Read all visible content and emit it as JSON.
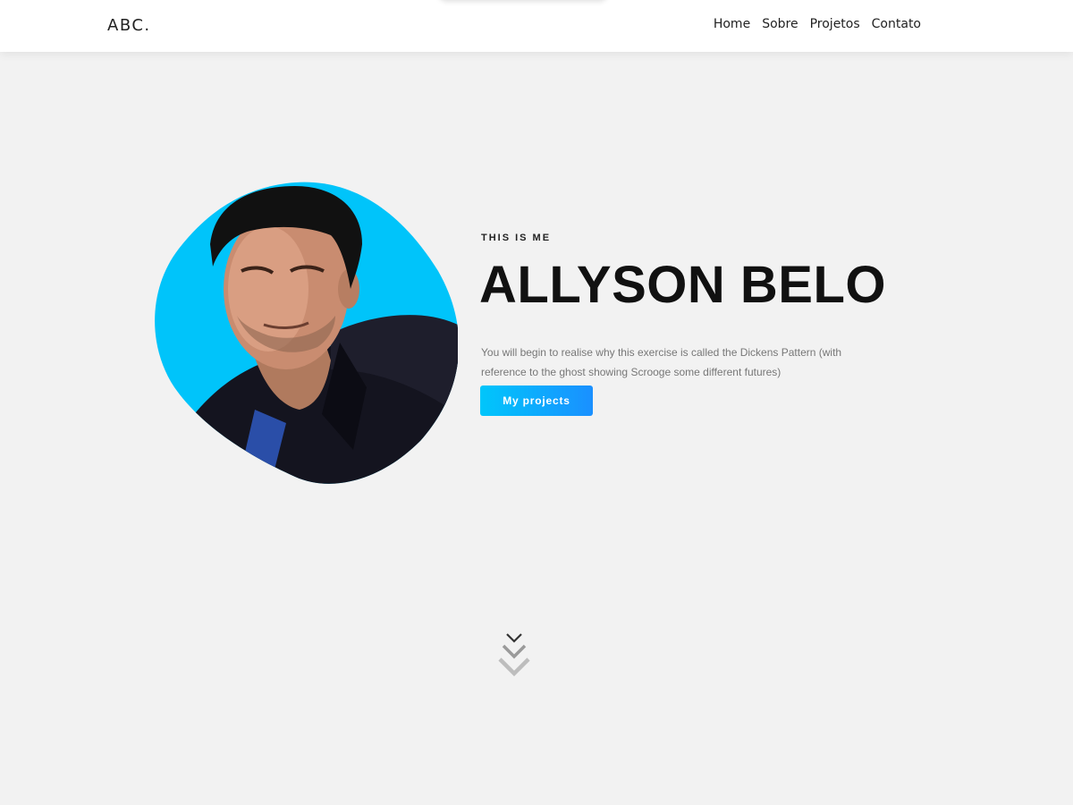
{
  "header": {
    "brand": "ABC.",
    "nav": [
      {
        "label": "Home"
      },
      {
        "label": "Sobre"
      },
      {
        "label": "Projetos"
      },
      {
        "label": "Contato"
      }
    ]
  },
  "hero": {
    "eyebrow": "THIS IS ME",
    "name": "ALLYSON BELO",
    "description": "You will begin to realise why this exercise is called the Dickens Pattern (with reference to the ghost showing Scrooge some different futures)",
    "cta_label": "My projects"
  },
  "icons": {
    "scroll": "triple-chevron-down-icon",
    "avatar": "profile-photo"
  },
  "colors": {
    "background": "#f2f2f2",
    "header_bg": "#ffffff",
    "accent_start": "#00c6fb",
    "accent_end": "#1a90ff",
    "avatar_bg": "#00c4fa",
    "text_dark": "#111111",
    "text_muted": "#777777"
  }
}
